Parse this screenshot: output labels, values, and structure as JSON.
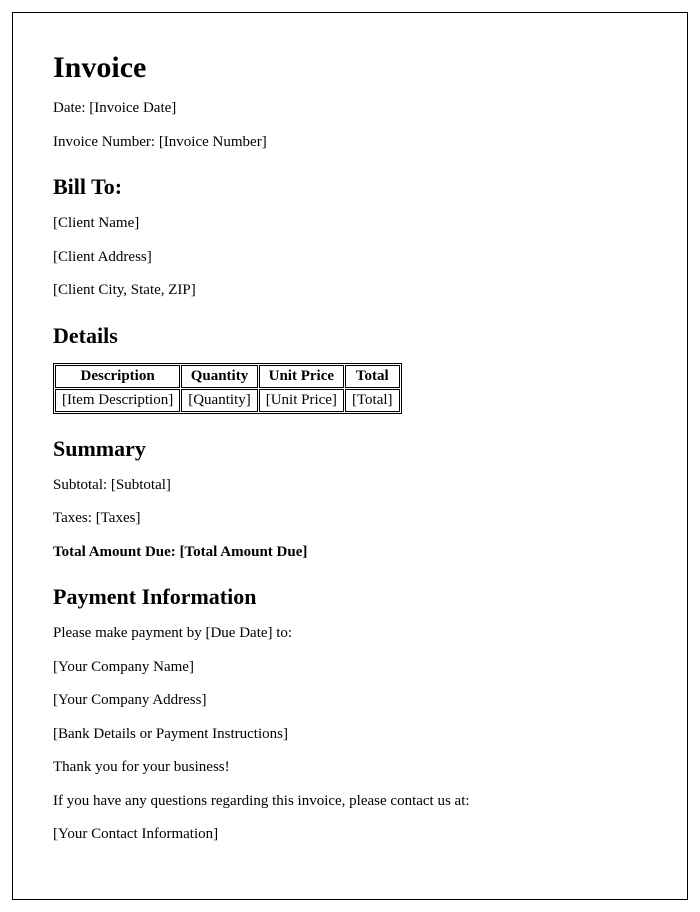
{
  "title": "Invoice",
  "date_label": "Date: ",
  "date_value": "[Invoice Date]",
  "invoice_number_label": "Invoice Number: ",
  "invoice_number_value": "[Invoice Number]",
  "bill_to": {
    "heading": "Bill To:",
    "client_name": "[Client Name]",
    "client_address": "[Client Address]",
    "client_city_state_zip": "[Client City, State, ZIP]"
  },
  "details": {
    "heading": "Details",
    "headers": {
      "description": "Description",
      "quantity": "Quantity",
      "unit_price": "Unit Price",
      "total": "Total"
    },
    "row": {
      "description": "[Item Description]",
      "quantity": "[Quantity]",
      "unit_price": "[Unit Price]",
      "total": "[Total]"
    }
  },
  "summary": {
    "heading": "Summary",
    "subtotal_label": "Subtotal: ",
    "subtotal_value": "[Subtotal]",
    "taxes_label": "Taxes: ",
    "taxes_value": "[Taxes]",
    "total_due_label": "Total Amount Due: ",
    "total_due_value": "[Total Amount Due]"
  },
  "payment": {
    "heading": "Payment Information",
    "line1_prefix": "Please make payment by ",
    "due_date": "[Due Date]",
    "line1_suffix": " to:",
    "company_name": "[Your Company Name]",
    "company_address": "[Your Company Address]",
    "bank_details": "[Bank Details or Payment Instructions]",
    "thank_you": "Thank you for your business!",
    "contact_intro": "If you have any questions regarding this invoice, please contact us at:",
    "contact_info": "[Your Contact Information]"
  }
}
